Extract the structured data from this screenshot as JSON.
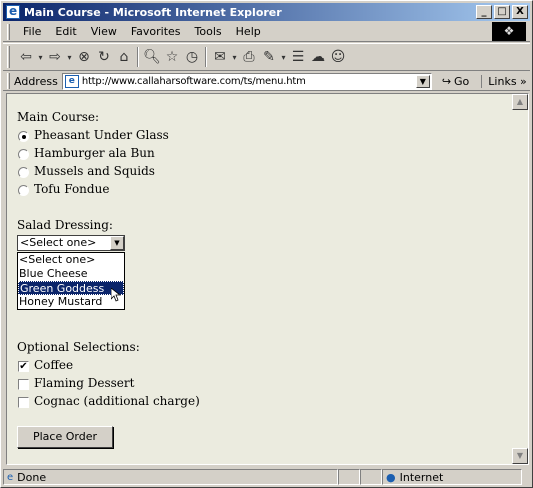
{
  "window": {
    "title": "Main Course - Microsoft Internet Explorer",
    "controls": {
      "minimize": "_",
      "maximize": "□",
      "close": "X"
    }
  },
  "menubar": {
    "items": [
      "File",
      "Edit",
      "View",
      "Favorites",
      "Tools",
      "Help"
    ]
  },
  "addressbar": {
    "label": "Address",
    "url": "http://www.callaharsoftware.com/ts/menu.htm",
    "go_label": "Go",
    "links_label": "Links »"
  },
  "form": {
    "main_course": {
      "label": "Main Course:",
      "options": [
        "Pheasant Under Glass",
        "Hamburger ala Bun",
        "Mussels and Squids",
        "Tofu Fondue"
      ],
      "selected_index": 0
    },
    "salad_dressing": {
      "label": "Salad Dressing:",
      "selected": "<Select one>",
      "options": [
        "<Select one>",
        "Blue Cheese",
        "Green Goddess",
        "Honey Mustard"
      ],
      "highlighted_index": 2
    },
    "optional": {
      "label": "Optional Selections:",
      "options": [
        {
          "label": "Coffee",
          "checked": true
        },
        {
          "label": "Flaming Dessert",
          "checked": false
        },
        {
          "label": "Cognac (additional charge)",
          "checked": false
        }
      ]
    },
    "submit_label": "Place Order"
  },
  "statusbar": {
    "status": "Done",
    "zone": "Internet"
  }
}
